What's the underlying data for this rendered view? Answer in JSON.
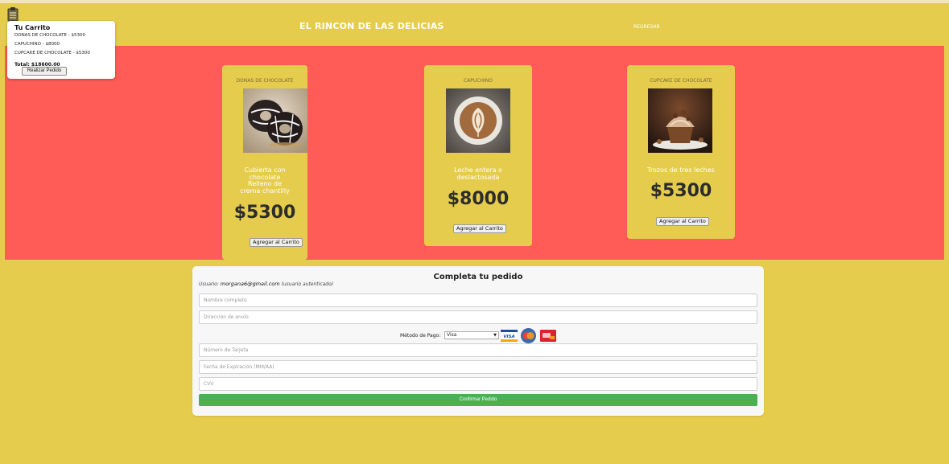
{
  "header": {
    "title": "EL RINCON DE LAS DELICIAS",
    "back_link": "REGRESAR"
  },
  "cart": {
    "title": "Tu Carrito",
    "items": [
      "DONAS DE CHOCOLATE - $5300",
      "CAPUCHINO - $8000",
      "CUPCAKE DE CHOCOLATE - $5300"
    ],
    "total": "Total: $18600.00",
    "order_button": "Realizar Pedido",
    "icon": "cart-clipboard-icon"
  },
  "products": [
    {
      "name": "DONAS DE CHOCOLATE",
      "description": [
        "Cubierta con chocolate",
        "Relleno de crema chantilly"
      ],
      "price": "$5300",
      "button": "Agregar al Carrito"
    },
    {
      "name": "CAPUCHINO",
      "description": [
        "Leche entera o deslactosada"
      ],
      "price": "$8000",
      "button": "Agregar al Carrito"
    },
    {
      "name": "CUPCAKE DE CHOCOLATE",
      "description": [
        "Trozos de tres leches"
      ],
      "price": "$5300",
      "button": "Agregar al Carrito"
    }
  ],
  "order": {
    "title": "Completa tu pedido",
    "user_prefix": "Usuario:",
    "user_email": "morgana6@gmail.com",
    "user_suffix": "(usuario autenticado)",
    "name_placeholder": "Nombre completo",
    "address_placeholder": "Dirección de envío",
    "payment_label": "Método de Pago:",
    "payment_selected": "Visa",
    "card_placeholder": "Número de Tarjeta",
    "expiry_placeholder": "Fecha de Expiración (MM/AA)",
    "cvv_placeholder": "CVV",
    "confirm_button": "Confirmar Pedido",
    "payment_icons": [
      "visa-icon",
      "mastercard-icon",
      "card-icon"
    ]
  },
  "colors": {
    "background": "#e5cc4c",
    "products_band": "#ff5b57",
    "card": "#e5cc4c",
    "confirm": "#4caf50"
  }
}
